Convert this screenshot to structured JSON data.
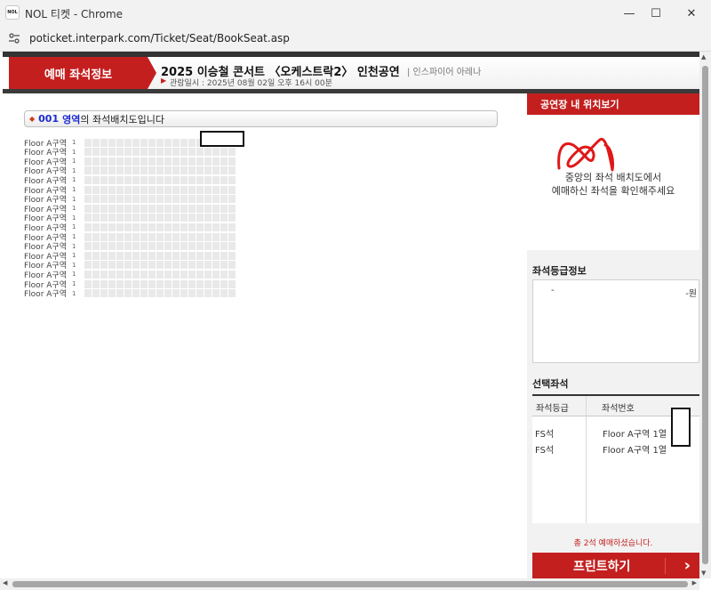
{
  "window": {
    "title": "NOL 티켓 - Chrome",
    "logo_text": "NOL",
    "url": "poticket.interpark.com/Ticket/Seat/BookSeat.asp"
  },
  "header": {
    "tab_label": "예매 좌석정보",
    "show_title": "2025 이승철 콘서트 〈오케스트락2〉 인천공연",
    "venue": "| 인스파이어 아레나",
    "date_label": "관람일시 : 2025년 08월 02일 오후 16시 00분"
  },
  "area": {
    "code": "001",
    "name": "영역",
    "description": "의 좌석배치도입니다"
  },
  "seat_rows": [
    {
      "label": "Floor A구역",
      "num": "1"
    },
    {
      "label": "Floor A구역",
      "num": "1"
    },
    {
      "label": "Floor A구역",
      "num": "1"
    },
    {
      "label": "Floor A구역",
      "num": "1"
    },
    {
      "label": "Floor A구역",
      "num": "1"
    },
    {
      "label": "Floor A구역",
      "num": "1"
    },
    {
      "label": "Floor A구역",
      "num": "1"
    },
    {
      "label": "Floor A구역",
      "num": "1"
    },
    {
      "label": "Floor A구역",
      "num": "1"
    },
    {
      "label": "Floor A구역",
      "num": "1"
    },
    {
      "label": "Floor A구역",
      "num": "1"
    },
    {
      "label": "Floor A구역",
      "num": "1"
    },
    {
      "label": "Floor A구역",
      "num": "1"
    },
    {
      "label": "Floor A구역",
      "num": "1"
    },
    {
      "label": "Floor A구역",
      "num": "1"
    },
    {
      "label": "Floor A구역",
      "num": "1"
    },
    {
      "label": "Floor A구역",
      "num": "1"
    }
  ],
  "panel": {
    "view_title": "공연장 내 위치보기",
    "view_msg1": "중앙의 좌석 배치도에서",
    "view_msg2": "예매하신 좌석을 확인해주세요",
    "grade_title": "좌석등급정보",
    "grade_name": "-",
    "grade_price": "-원",
    "selected_title": "선택좌석",
    "col_grade": "좌석등급",
    "col_seat": "좌석번호",
    "selected": [
      {
        "grade": "FS석",
        "seat": "Floor A구역 1열"
      },
      {
        "grade": "FS석",
        "seat": "Floor A구역 1열"
      }
    ],
    "total_text": "총 2석 예매하셨습니다.",
    "print_label": "프린트하기"
  },
  "colors": {
    "accent_red": "#c41f1f",
    "link_blue": "#1a2ad0"
  }
}
